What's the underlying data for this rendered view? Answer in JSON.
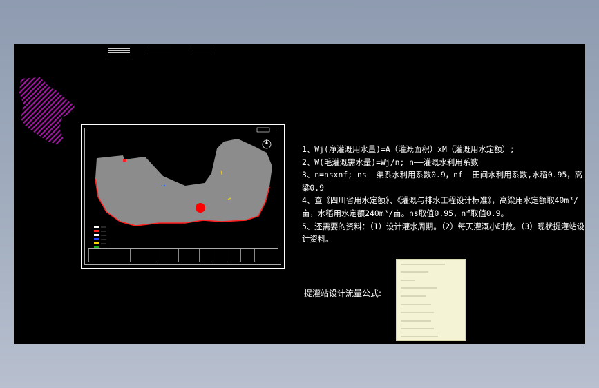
{
  "header_marks": [
    "",
    "",
    ""
  ],
  "map": {
    "station_label": "",
    "colors": {
      "terrain": "#8c8c8c",
      "boundary": "#ff2020",
      "station": "#ff0000",
      "hatch": "#9b1a9b",
      "card_bg": "#f5f3d6"
    }
  },
  "notes": {
    "line1": "1、Wj(净灌溉用水量)=A（灌溉面积）xM（灌溉用水定额）;",
    "line2": "2、W(毛灌溉需水量)=Wj/n; n——灌溉水利用系数",
    "line3": "3、n=nsxnf; ns——渠系水利用系数0.9，nf——田间水利用系数,水稻0.95，高粱0.9",
    "line4": "4、查《四川省用水定额》、《灌溉与排水工程设计标准》，高粱用水定额取40m³/亩，水稻用水定额240m³/亩。ns取值0.95，nf取值0.9。",
    "line5": "5、还需要的资料：（1）设计灌水周期。（2）每天灌溉小时数。（3）现状提灌站设计资料。"
  },
  "formula_label": "提灌站设计流量公式:",
  "formula_card": {
    "lines": [
      "",
      "",
      "",
      "",
      "",
      "",
      "",
      "",
      "",
      ""
    ]
  }
}
